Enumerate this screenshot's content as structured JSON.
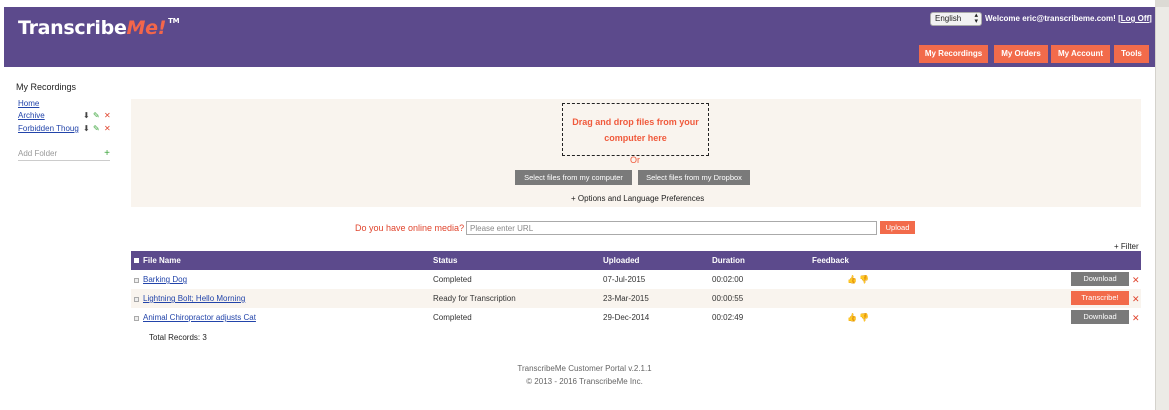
{
  "header": {
    "logo_main": "Transcribe",
    "logo_accent": "Me",
    "logo_bang": "!",
    "logo_tm": "TM",
    "language": "English",
    "welcome": "Welcome eric@transcribeme.com!",
    "bracket_open": "[",
    "logoff": "Log Off",
    "bracket_close": "]",
    "nav": [
      "My Recordings",
      "My Orders",
      "My Account",
      "Tools"
    ]
  },
  "sidebar": {
    "title": "My Recordings",
    "folders": [
      "Home",
      "Archive",
      "Forbidden Thoug"
    ],
    "add_folder": "Add Folder",
    "add_icon": "+",
    "download_icon": "⬇",
    "edit_icon": "✎",
    "delete_icon": "✕"
  },
  "upload": {
    "dropzone_line1": "Drag and drop files from your",
    "dropzone_line2": "computer here",
    "or": "Or",
    "select_computer": "Select files from my computer",
    "select_dropbox": "Select files from my Dropbox",
    "options": "+ Options and Language Preferences",
    "media_question": "Do you have online media?",
    "url_placeholder": "Please enter URL",
    "upload_button": "Upload"
  },
  "table": {
    "filter": "+ Filter",
    "headers": [
      "File Name",
      "Status",
      "Uploaded",
      "Duration",
      "Feedback"
    ],
    "rows": [
      {
        "name": "Barking Dog",
        "status": "Completed",
        "uploaded": "07-Jul-2015",
        "duration": "00:02:00",
        "thumbs": "👍 👎",
        "action": "Download",
        "action_color": "#7a7a7a"
      },
      {
        "name": "Lightning Bolt; Hello Morning",
        "status": "Ready for Transcription",
        "uploaded": "23-Mar-2015",
        "duration": "00:00:55",
        "thumbs": "",
        "action": "Transcribe!",
        "action_color": "#f26b4b"
      },
      {
        "name": "Animal Chiropractor adjusts Cat",
        "status": "Completed",
        "uploaded": "29-Dec-2014",
        "duration": "00:02:49",
        "thumbs": "👍 👎",
        "action": "Download",
        "action_color": "#7a7a7a"
      }
    ],
    "total": "Total Records: 3"
  },
  "footer": {
    "line1": "TranscribeMe Customer Portal v.2.1.1",
    "line2": "© 2013 - 2016 TranscribeMe Inc."
  },
  "colors": {
    "brand_purple": "#5c4a8c",
    "accent_orange": "#f26b4b"
  }
}
